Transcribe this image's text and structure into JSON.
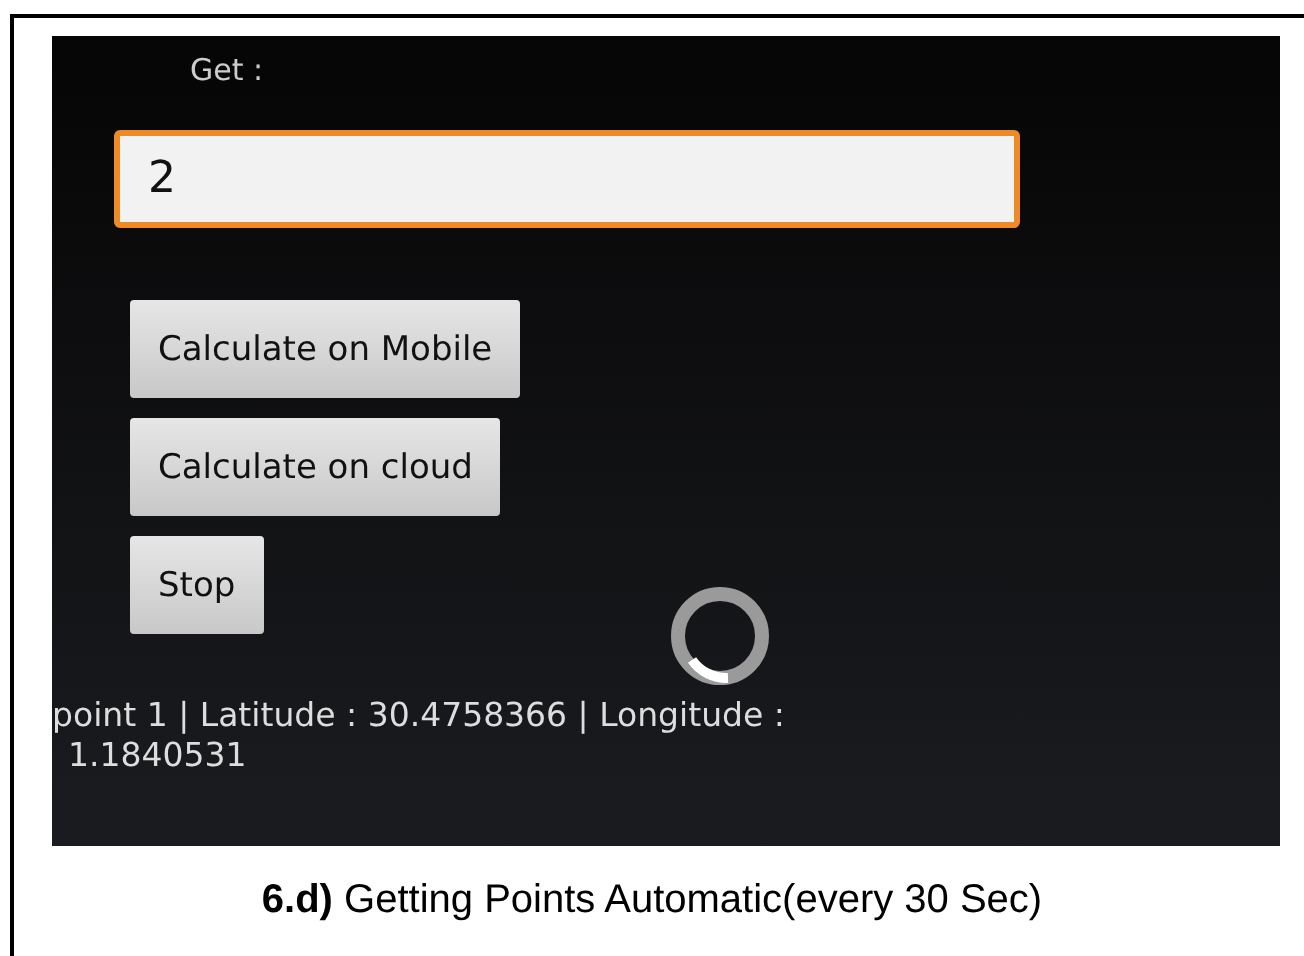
{
  "screen": {
    "label": "Get :",
    "input": {
      "value": "2",
      "focused": true
    },
    "buttons": [
      {
        "label": "Calculate on Mobile"
      },
      {
        "label": "Calculate on cloud"
      },
      {
        "label": "Stop"
      }
    ],
    "loading": true,
    "result_lines": [
      "point 1 | Latitude : 30.4758366 | Longitude :",
      "1.1840531"
    ]
  },
  "caption": {
    "number": "6.d)",
    "text": "Getting Points Automatic(every 30 Sec)"
  }
}
